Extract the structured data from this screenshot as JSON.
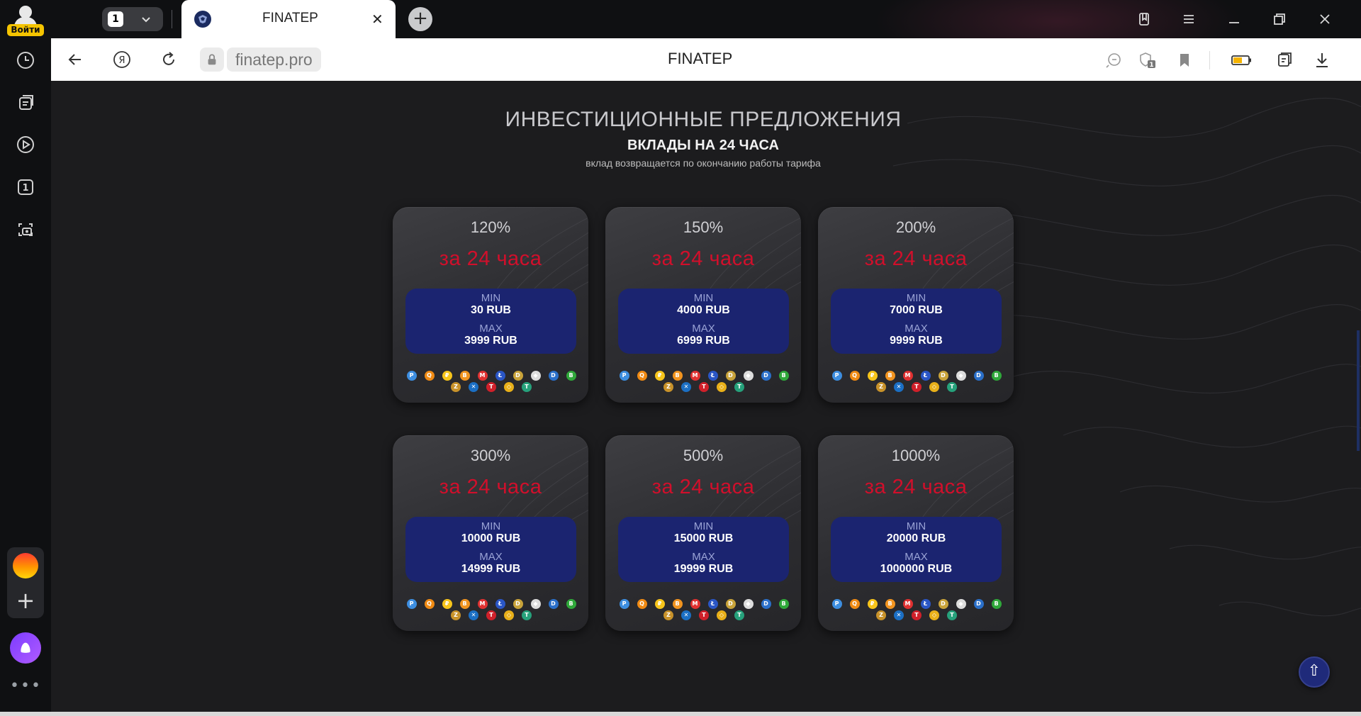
{
  "browser": {
    "login_label": "Войти",
    "tab_count": "1",
    "tab_title": "FINATEP",
    "tab_close": "✕",
    "new_tab": "+",
    "url": "finatep.pro",
    "page_heading": "FINATEP",
    "yandex_glyph": "Я",
    "sidebar_badge": "1",
    "protect_badge": "1",
    "more": "•••",
    "scroll_top": "⇧"
  },
  "section": {
    "title": "ИНВЕСТИЦИОННЫЕ ПРЕДЛОЖЕНИЯ",
    "subtitle": "ВКЛАДЫ НА 24 ЧАСА",
    "note": "вклад возвращается по окончанию работы тарифа"
  },
  "plans": [
    {
      "percent": "120%",
      "period": "за 24 часа",
      "min_label": "MIN",
      "min": "30 RUB",
      "max_label": "MAX",
      "max": "3999 RUB"
    },
    {
      "percent": "150%",
      "period": "за 24 часа",
      "min_label": "MIN",
      "min": "4000 RUB",
      "max_label": "MAX",
      "max": "6999 RUB"
    },
    {
      "percent": "200%",
      "period": "за 24 часа",
      "min_label": "MIN",
      "min": "7000 RUB",
      "max_label": "MAX",
      "max": "9999 RUB"
    },
    {
      "percent": "300%",
      "period": "за 24 часа",
      "min_label": "MIN",
      "min": "10000 RUB",
      "max_label": "MAX",
      "max": "14999 RUB"
    },
    {
      "percent": "500%",
      "period": "за 24 часа",
      "min_label": "MIN",
      "min": "15000 RUB",
      "max_label": "MAX",
      "max": "19999 RUB"
    },
    {
      "percent": "1000%",
      "period": "за 24 часа",
      "min_label": "MIN",
      "min": "20000 RUB",
      "max_label": "MAX",
      "max": "1000000 RUB"
    }
  ],
  "payment_icons": {
    "row1": [
      {
        "name": "payeer-icon",
        "color": "#3d8ee0",
        "glyph": "P"
      },
      {
        "name": "qiwi-icon",
        "color": "#f08a13",
        "glyph": "Q"
      },
      {
        "name": "yoomoney-icon",
        "color": "#f7c51b",
        "glyph": "₽"
      },
      {
        "name": "bitcoin-icon",
        "color": "#f2941f",
        "glyph": "B"
      },
      {
        "name": "perfect-money-icon",
        "color": "#e03131",
        "glyph": "M"
      },
      {
        "name": "litecoin-icon",
        "color": "#2a56c6",
        "glyph": "Ł"
      },
      {
        "name": "dogecoin-icon",
        "color": "#c9a33a",
        "glyph": "D"
      },
      {
        "name": "ethereum-icon",
        "color": "#dddddd",
        "glyph": "◆"
      },
      {
        "name": "dash-icon",
        "color": "#2a6fc9",
        "glyph": "D"
      },
      {
        "name": "bitcoin-cash-icon",
        "color": "#2fa83a",
        "glyph": "B"
      }
    ],
    "row2": [
      {
        "name": "zcash-icon",
        "color": "#c8922a",
        "glyph": "Z"
      },
      {
        "name": "ripple-icon",
        "color": "#1b6fc4",
        "glyph": "✕"
      },
      {
        "name": "tron-icon",
        "color": "#d0202a",
        "glyph": "T"
      },
      {
        "name": "bnb-icon",
        "color": "#e9b019",
        "glyph": "◇"
      },
      {
        "name": "tether-icon",
        "color": "#26a17b",
        "glyph": "T"
      }
    ]
  }
}
